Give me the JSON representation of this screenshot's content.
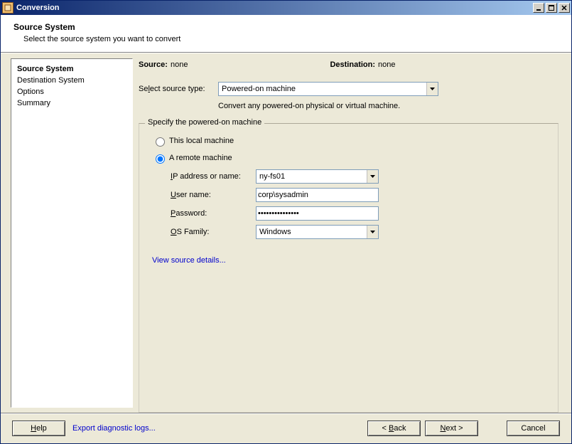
{
  "window": {
    "title": "Conversion"
  },
  "header": {
    "title": "Source System",
    "subtitle": "Select the source system you want to convert"
  },
  "sidebar": {
    "items": [
      {
        "label": "Source System",
        "active": true
      },
      {
        "label": "Destination System",
        "active": false
      },
      {
        "label": "Options",
        "active": false
      },
      {
        "label": "Summary",
        "active": false
      }
    ]
  },
  "main": {
    "source_label": "Source:",
    "source_value": "none",
    "dest_label": "Destination:",
    "dest_value": "none",
    "source_type_label": "Select source type:",
    "source_type_value": "Powered-on machine",
    "source_type_hint": "Convert any powered-on physical or virtual machine.",
    "group_legend": "Specify the powered-on machine",
    "radio_local": "This local machine",
    "radio_remote": "A remote machine",
    "radio_selected": "remote",
    "ip_label": "IP address or name:",
    "ip_value": "ny-fs01",
    "user_label": "User name:",
    "user_value": "corp\\sysadmin",
    "pass_label": "Password:",
    "pass_value": "•••••••••••••••",
    "osfam_label": "OS Family:",
    "osfam_value": "Windows",
    "view_details": "View source details..."
  },
  "footer": {
    "help": "Help",
    "export": "Export diagnostic logs...",
    "back": "< Back",
    "next": "Next >",
    "cancel": "Cancel"
  }
}
